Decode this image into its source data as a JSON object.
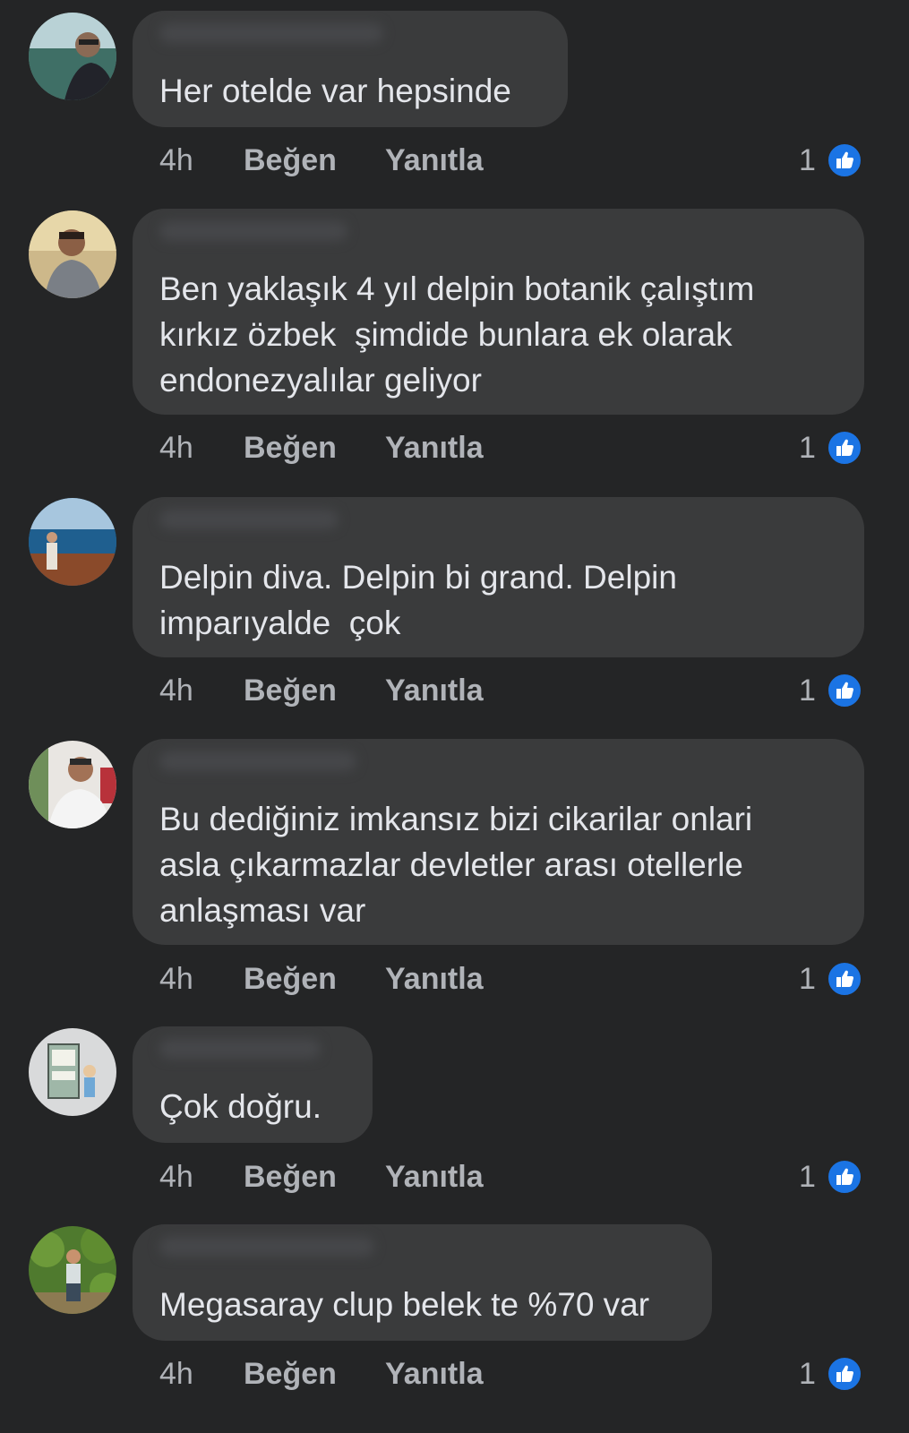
{
  "comments": [
    {
      "text": "Her otelde var hepsinde",
      "time": "4h",
      "like_label": "Beğen",
      "reply_label": "Yanıtla",
      "reaction_count": "1",
      "reaction_icon": "like-icon"
    },
    {
      "text": "Ben yaklaşık 4 yıl delpin botanik çalıştım\nkırkız özbek  şimdide bunlara ek olarak\nendonezyalılar geliyor",
      "time": "4h",
      "like_label": "Beğen",
      "reply_label": "Yanıtla",
      "reaction_count": "1",
      "reaction_icon": "like-icon"
    },
    {
      "text": "Delpin diva. Delpin bi grand. Delpin\nimparıyalde  çok",
      "time": "4h",
      "like_label": "Beğen",
      "reply_label": "Yanıtla",
      "reaction_count": "1",
      "reaction_icon": "like-icon"
    },
    {
      "text": "Bu dediğiniz imkansız bizi cikarilar onlari\nasla çıkarmazlar devletler arası otellerle\nanlaşması var",
      "time": "4h",
      "like_label": "Beğen",
      "reply_label": "Yanıtla",
      "reaction_count": "1",
      "reaction_icon": "like-icon"
    },
    {
      "text": "Çok doğru.",
      "time": "4h",
      "like_label": "Beğen",
      "reply_label": "Yanıtla",
      "reaction_count": "1",
      "reaction_icon": "like-icon"
    },
    {
      "text": "Megasaray clup belek te %70 var",
      "time": "4h",
      "like_label": "Beğen",
      "reply_label": "Yanıtla",
      "reaction_count": "1",
      "reaction_icon": "like-icon"
    }
  ],
  "colors": {
    "background": "#242526",
    "bubble": "#3a3b3c",
    "text": "#e4e6eb",
    "secondary_text": "#b0b3b8",
    "like_blue": "#1b74e4"
  }
}
